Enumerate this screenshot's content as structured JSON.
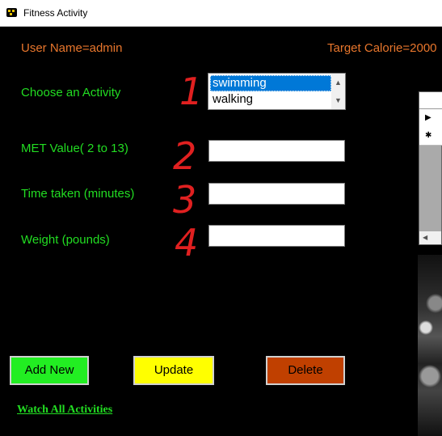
{
  "window": {
    "title": "Fitness Activity"
  },
  "header": {
    "user": "User Name=admin",
    "target": "Target Calorie=2000"
  },
  "form": {
    "activity_label": "Choose an Activity",
    "activities": [
      "swimming",
      "walking"
    ],
    "selected_activity": "swimming",
    "met_label": "MET Value( 2 to 13)",
    "time_label": "Time taken (minutes)",
    "weight_label": "Weight (pounds)",
    "met_value": "",
    "time_value": "",
    "weight_value": ""
  },
  "annotations": [
    "1",
    "2",
    "3",
    "4"
  ],
  "buttons": {
    "add": "Add New",
    "update": "Update",
    "delete": "Delete"
  },
  "link": {
    "watch_all": "Watch All Activities"
  },
  "colors": {
    "label_green": "#22dd22",
    "header_orange": "#e8762c",
    "annotation_red": "#e02020",
    "add_bg": "#22ee22",
    "update_bg": "#ffff00",
    "delete_bg": "#c04000",
    "selection_blue": "#0078d7"
  }
}
